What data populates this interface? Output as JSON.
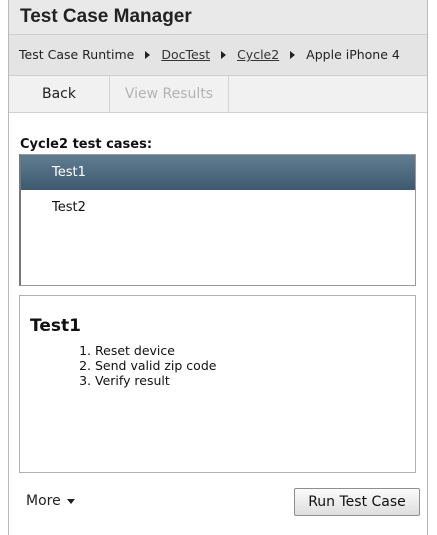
{
  "app": {
    "title": "Test Case Manager"
  },
  "breadcrumb": {
    "items": [
      {
        "label": "Test Case Runtime",
        "link": false
      },
      {
        "label": "DocTest",
        "link": true
      },
      {
        "label": "Cycle2",
        "link": true
      },
      {
        "label": "Apple iPhone 4",
        "link": false
      }
    ]
  },
  "toolbar": {
    "back_label": "Back",
    "view_results_label": "View Results",
    "view_results_enabled": false
  },
  "test_cases": {
    "heading": "Cycle2 test cases:",
    "items": [
      {
        "label": "Test1",
        "selected": true
      },
      {
        "label": "Test2",
        "selected": false
      }
    ]
  },
  "detail": {
    "title": "Test1",
    "steps": [
      "Reset device",
      "Send valid zip code",
      "Verify result"
    ]
  },
  "footer": {
    "more_label": "More",
    "run_label": "Run Test Case"
  },
  "colors": {
    "selected_row": "#4d6b80",
    "title_bar": "#e9e9e9"
  }
}
